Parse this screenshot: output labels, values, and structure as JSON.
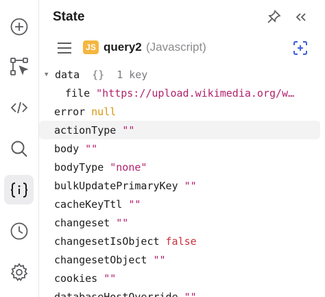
{
  "rail": {
    "items": [
      {
        "name": "add-icon"
      },
      {
        "name": "flow-icon"
      },
      {
        "name": "code-icon"
      },
      {
        "name": "search-icon"
      },
      {
        "name": "state-icon",
        "active": true
      },
      {
        "name": "history-icon"
      },
      {
        "name": "settings-icon"
      }
    ]
  },
  "header": {
    "title": "State",
    "pin_icon": "pin-icon",
    "collapse_icon": "collapse-icon"
  },
  "subheader": {
    "menu_icon": "menu-icon",
    "badge": "JS",
    "query_name": "query2",
    "query_type": "(Javascript)",
    "focus_icon": "focus-icon"
  },
  "tree": {
    "data": {
      "key": "data",
      "type": "{}",
      "count": "1 key"
    },
    "file": {
      "key": "file",
      "value": "\"https://upload.wikimedia.org/w…"
    },
    "rows": [
      {
        "key": "error",
        "value": "null",
        "kind": "kw"
      },
      {
        "key": "actionType",
        "value": "\"\"",
        "kind": "str",
        "highlight": true
      },
      {
        "key": "body",
        "value": "\"\"",
        "kind": "str"
      },
      {
        "key": "bodyType",
        "value": "\"none\"",
        "kind": "str"
      },
      {
        "key": "bulkUpdatePrimaryKey",
        "value": "\"\"",
        "kind": "str"
      },
      {
        "key": "cacheKeyTtl",
        "value": "\"\"",
        "kind": "str"
      },
      {
        "key": "changeset",
        "value": "\"\"",
        "kind": "str"
      },
      {
        "key": "changesetIsObject",
        "value": "false",
        "kind": "bool"
      },
      {
        "key": "changesetObject",
        "value": "\"\"",
        "kind": "str"
      },
      {
        "key": "cookies",
        "value": "\"\"",
        "kind": "str"
      },
      {
        "key": "databaseHostOverride",
        "value": "\"\"",
        "kind": "str"
      }
    ]
  },
  "colors": {
    "string": "#b0226c",
    "null": "#d89614",
    "boolean": "#c9303a",
    "badge": "#f4b740",
    "accent": "#3b5bdb"
  }
}
